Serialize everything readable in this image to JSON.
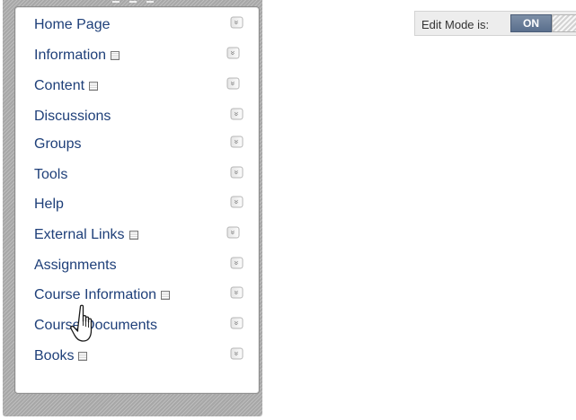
{
  "course_menu": {
    "items": [
      {
        "label": "Home Page",
        "has_page_icon": false
      },
      {
        "label": "Information",
        "has_page_icon": true
      },
      {
        "label": "Content",
        "has_page_icon": true
      },
      {
        "label": "Discussions",
        "has_page_icon": false
      },
      {
        "label": "Groups",
        "has_page_icon": false
      },
      {
        "label": "Tools",
        "has_page_icon": false
      },
      {
        "label": "Help",
        "has_page_icon": false
      },
      {
        "label": "External Links",
        "has_page_icon": true
      },
      {
        "label": "Assignments",
        "has_page_icon": false
      },
      {
        "label": "Course Information",
        "has_page_icon": true
      },
      {
        "label": "Course Documents",
        "has_page_icon": false
      },
      {
        "label": "Books",
        "has_page_icon": true
      }
    ],
    "item_chevron_icon": "double-chevron-down-icon",
    "page_icon": "empty-page-icon"
  },
  "edit_mode": {
    "label": "Edit Mode is:",
    "state": "ON"
  },
  "cursor": {
    "icon": "hand-pointer-icon"
  },
  "colors": {
    "menu_link": "#1e3f79",
    "edit_mode_on": "#5a6f8d"
  }
}
